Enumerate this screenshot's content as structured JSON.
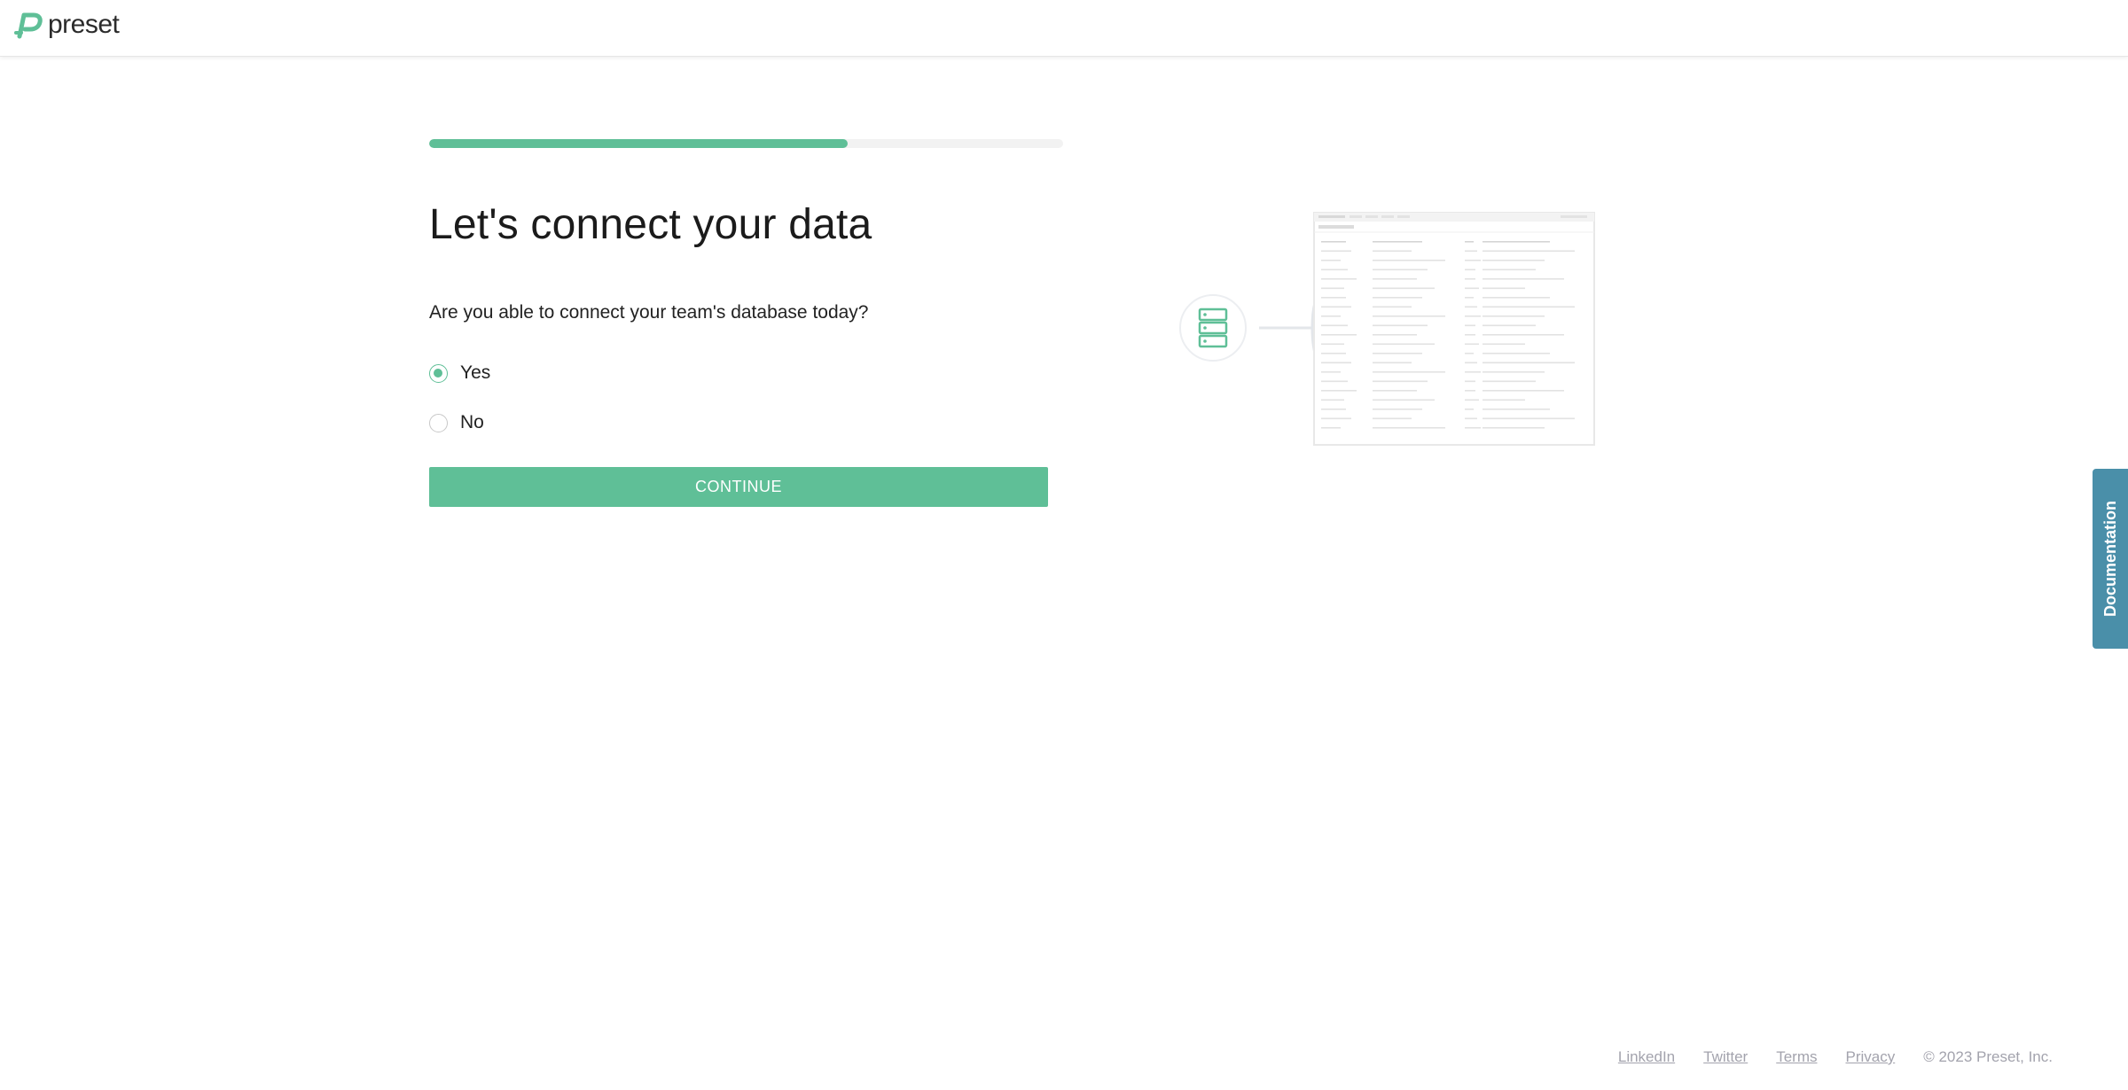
{
  "header": {
    "logo_text": "preset",
    "brand_color": "#5fbf97"
  },
  "onboarding": {
    "progress_fraction": 0.66,
    "title": "Let's connect your data",
    "question": "Are you able to connect your team's database today?",
    "options": [
      {
        "label": "Yes",
        "selected": true
      },
      {
        "label": "No",
        "selected": false
      }
    ],
    "continue_label": "CONTINUE"
  },
  "illustration": {
    "database_icon": "database-icon",
    "preview_icon": "table-preview"
  },
  "side_tab": {
    "label": "Documentation",
    "color": "#4a8fa9"
  },
  "footer": {
    "links": [
      "LinkedIn",
      "Twitter",
      "Terms",
      "Privacy"
    ],
    "copyright": "© 2023 Preset, Inc."
  }
}
